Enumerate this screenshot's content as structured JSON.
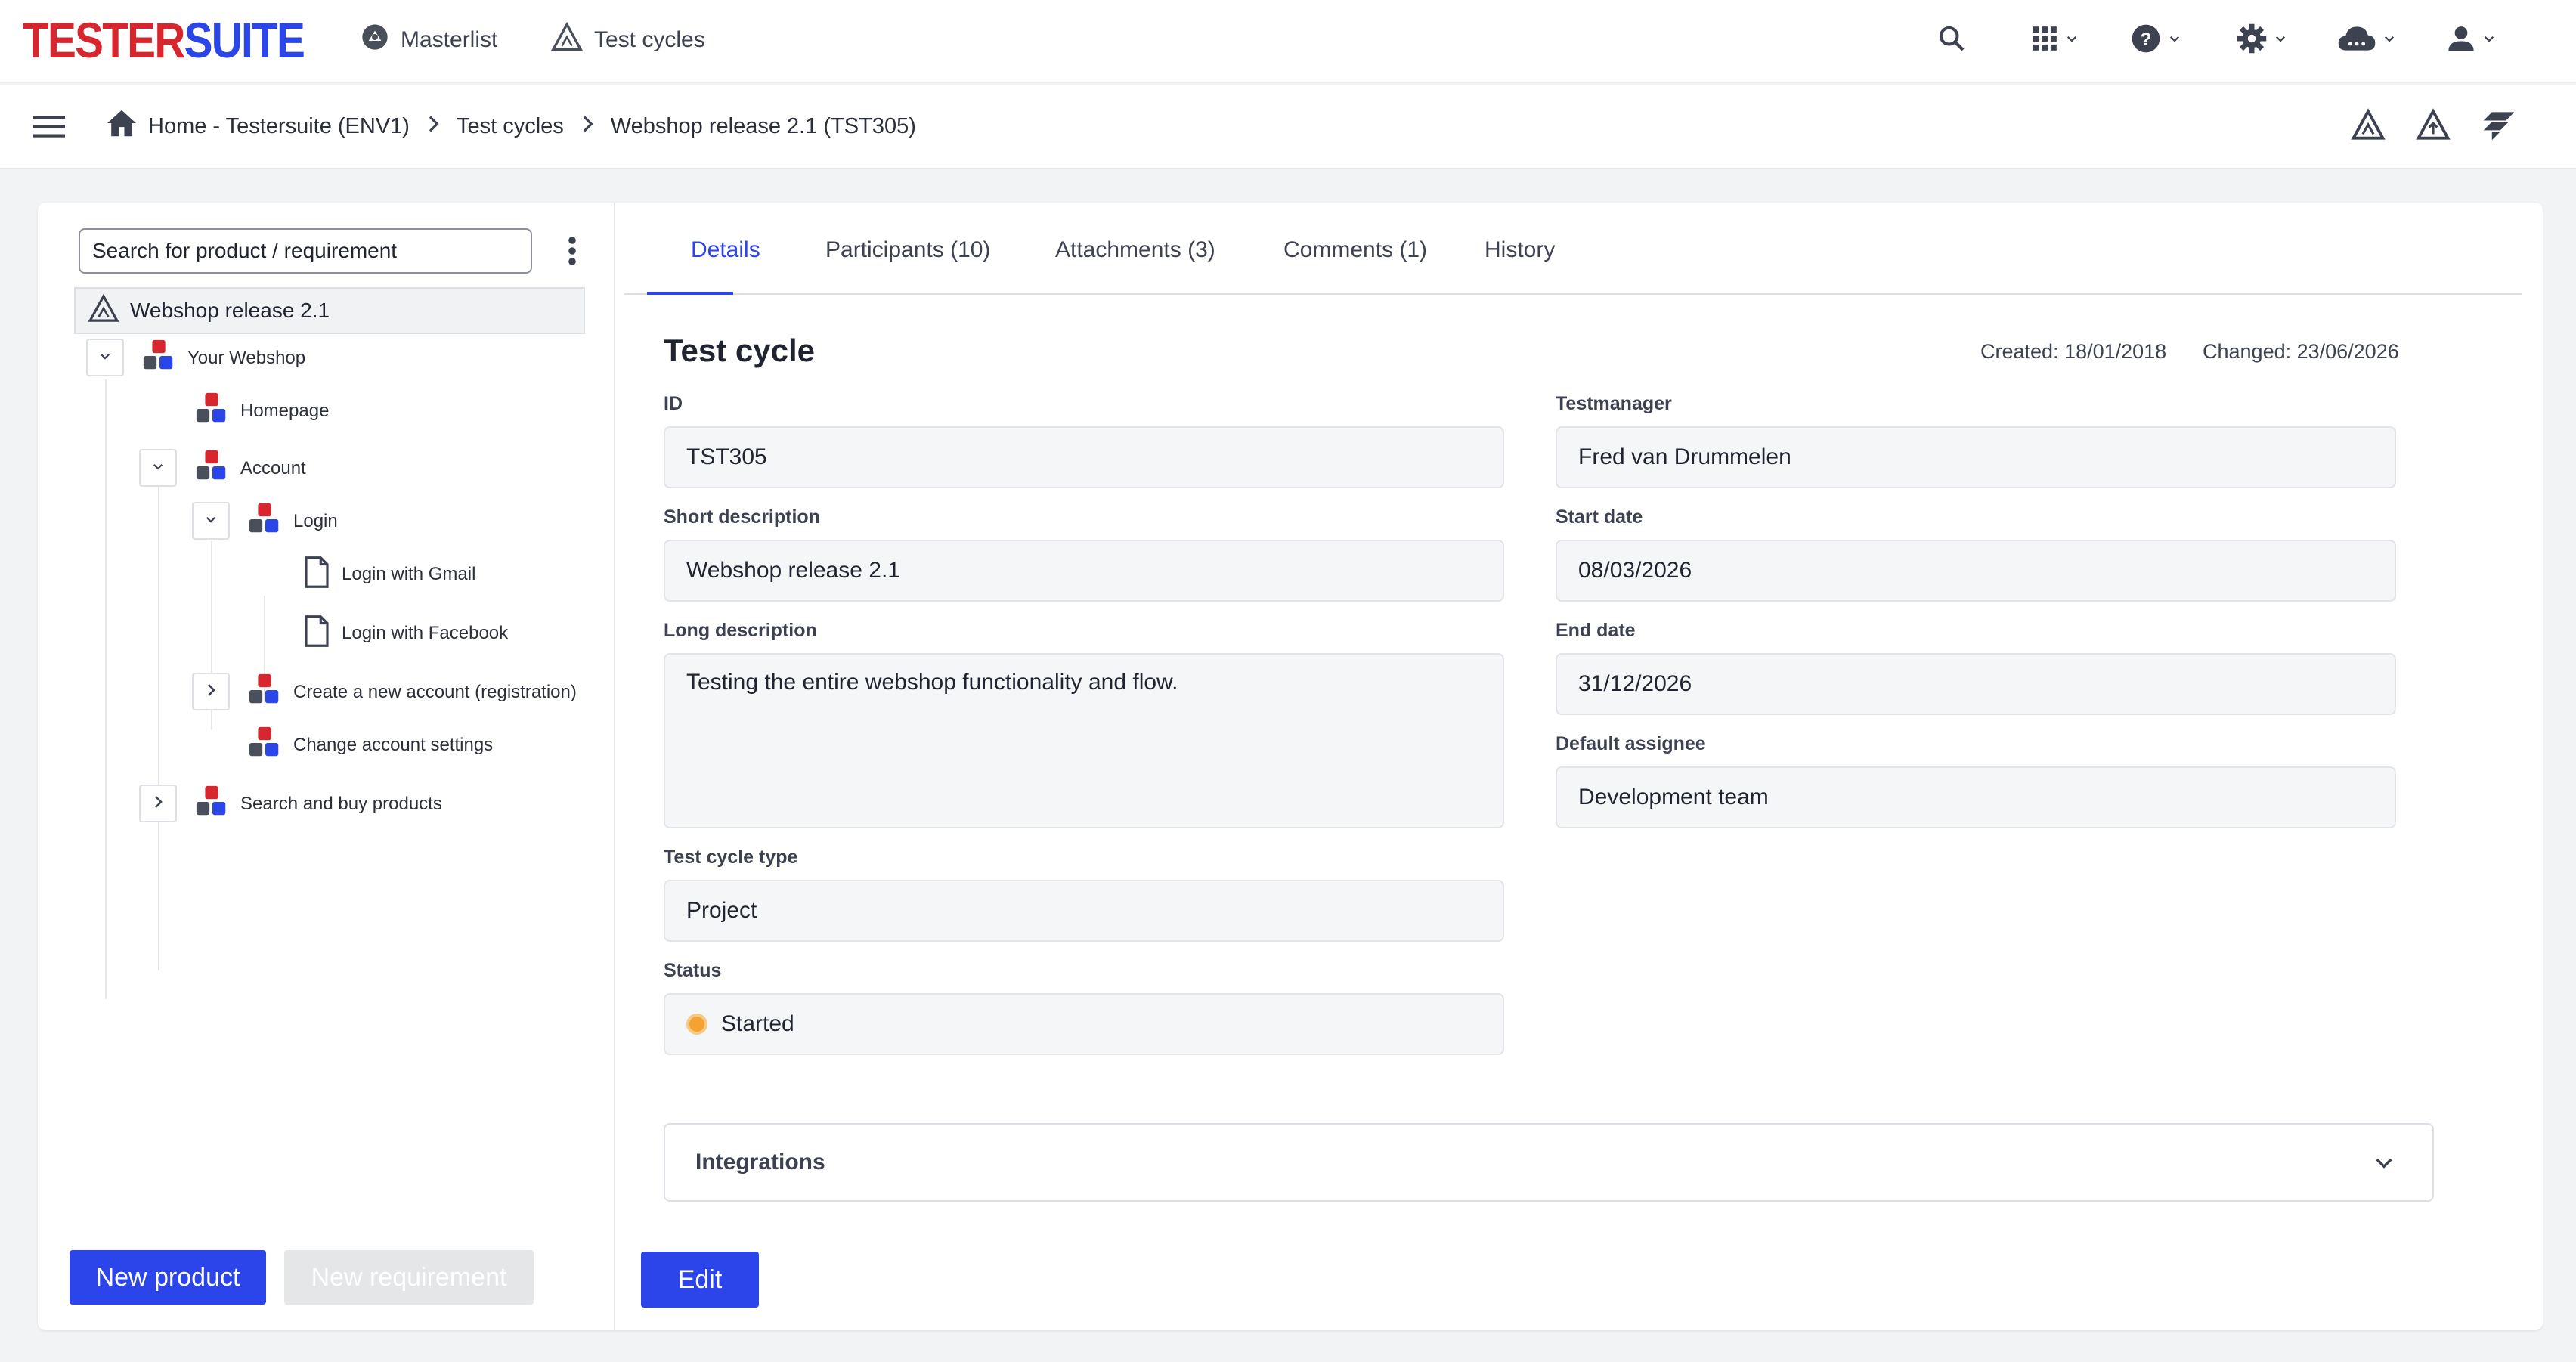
{
  "app": {
    "logo_part1": "TESTER",
    "logo_part2": "SUITE"
  },
  "topnav": {
    "links": [
      {
        "label": "Masterlist",
        "icon": "masterlist-icon"
      },
      {
        "label": "Test cycles",
        "icon": "test-cycles-icon"
      }
    ],
    "icons": [
      "search-icon",
      "apps-grid-icon",
      "help-icon",
      "settings-gear-icon",
      "cloud-icon",
      "user-icon"
    ]
  },
  "breadcrumb": {
    "items": [
      "Home - Testersuite (ENV1)",
      "Test cycles",
      "Webshop release 2.1 (TST305)"
    ],
    "actions": [
      "test-cycle-icon",
      "test-cycle-up-icon",
      "jira-icon"
    ]
  },
  "left": {
    "search_placeholder": "Search for product / requirement",
    "root": "Webshop release 2.1",
    "tree": {
      "your_webshop": "Your Webshop",
      "homepage": "Homepage",
      "account": "Account",
      "login": "Login",
      "login_gmail": "Login with Gmail",
      "login_facebook": "Login with Facebook",
      "create_account": "Create a new account (registration)",
      "change_settings": "Change account settings",
      "search_buy": "Search and buy products"
    },
    "new_product": "New product",
    "new_requirement": "New requirement"
  },
  "tabs": [
    "Details",
    "Participants (10)",
    "Attachments (3)",
    "Comments (1)",
    "History"
  ],
  "details": {
    "title": "Test cycle",
    "created": "Created: 18/01/2018",
    "changed": "Changed: 23/06/2026",
    "labels": {
      "id": "ID",
      "short": "Short description",
      "long": "Long description",
      "type": "Test cycle type",
      "status": "Status",
      "manager": "Testmanager",
      "start": "Start date",
      "end": "End date",
      "assignee": "Default assignee"
    },
    "values": {
      "id": "TST305",
      "short": "Webshop release 2.1",
      "long": "Testing the entire webshop functionality and flow.",
      "type": "Project",
      "status": "Started",
      "manager": "Fred van Drummelen",
      "start": "08/03/2026",
      "end": "31/12/2026",
      "assignee": "Development team"
    },
    "integrations": "Integrations",
    "edit": "Edit"
  },
  "colors": {
    "accent": "#2b45ea",
    "brand_red": "#d8262f",
    "status_started": "#f4a230"
  }
}
